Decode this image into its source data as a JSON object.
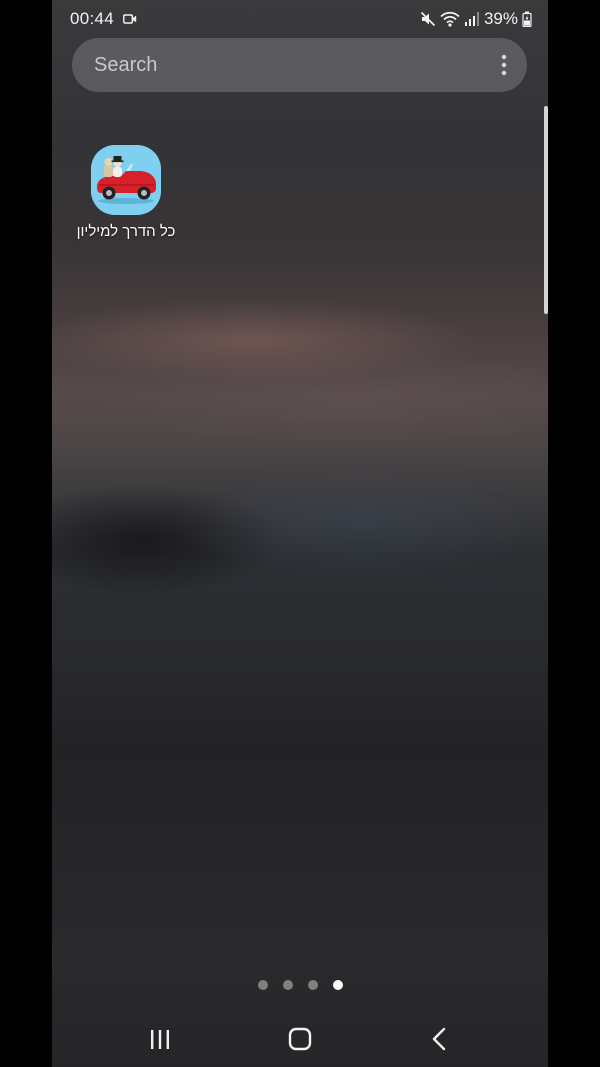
{
  "status_bar": {
    "time": "00:44",
    "battery": "39%",
    "icons": [
      "video-record-icon",
      "mute-icon",
      "wifi-icon",
      "signal-icon",
      "battery-icon"
    ]
  },
  "search": {
    "placeholder": "Search",
    "menu_icon": "more-vertical-icon"
  },
  "apps": [
    {
      "label": "כל הדרך למיליון",
      "icon": "red-convertible-car-icon",
      "icon_bg": "#7fd0f0"
    }
  ],
  "pager": {
    "pages": 4,
    "current": 4
  },
  "nav": {
    "recent": "recent-apps-icon",
    "home": "home-icon",
    "back": "back-icon"
  }
}
